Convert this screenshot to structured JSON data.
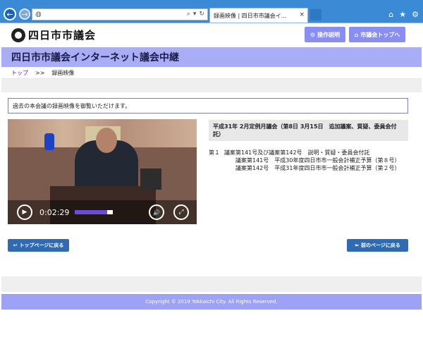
{
  "browser": {
    "tab_title": "録画映像 | 四日市市議会イ...",
    "icons": [
      "back-icon",
      "forward-icon",
      "globe-icon",
      "search-icon",
      "refresh-icon",
      "home-icon",
      "star-icon",
      "gear-icon"
    ]
  },
  "header": {
    "logo_text": "四日市市議会",
    "help_button": "操作説明",
    "top_button": "市議会トップへ"
  },
  "title": "四日市市議会インターネット議会中継",
  "breadcrumb": {
    "home": "トップ",
    "separator": ">>",
    "current": "録画映像"
  },
  "notice": "過去の本会議の録画映像を御覧いただけます。",
  "video": {
    "time": "0:02:29",
    "progress": 0.85
  },
  "session": {
    "title": "平成31年 2月定例月議会（第8日 3月15日　追加議案、質疑、委員会付託）",
    "agenda": [
      {
        "num": "第１",
        "text": "議案第141号及び議案第142号　説明・質疑・委員会付託"
      },
      {
        "num": "",
        "text": "議案第141号　平成30年度四日市市一般会計補正予算（第８号）"
      },
      {
        "num": "",
        "text": "議案第142号　平成31年度四日市市一般会計補正予算（第２号）"
      }
    ]
  },
  "buttons": {
    "back_top": "トップページに戻る",
    "back_prev": "前のページに戻る"
  },
  "footer": "Copyright © 2019 Yokkaichi City. All Rights Reserved."
}
